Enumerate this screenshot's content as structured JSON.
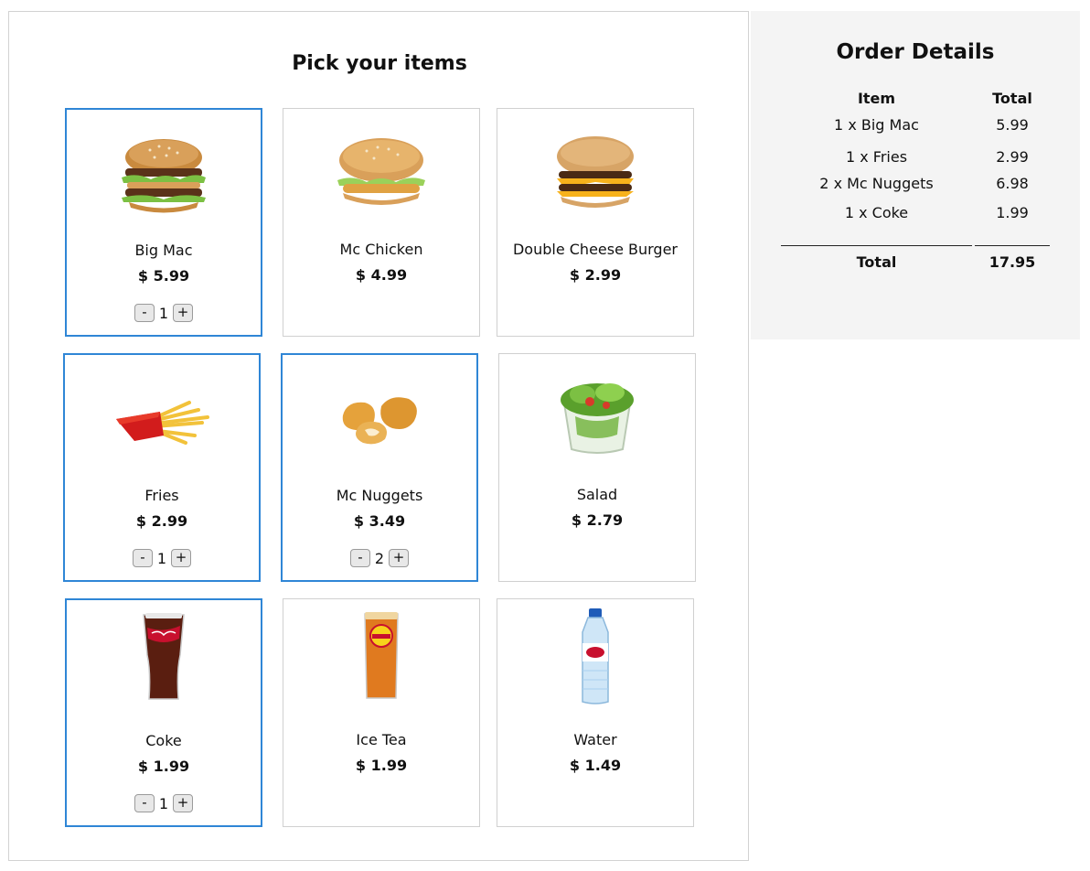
{
  "menu": {
    "title": "Pick your items",
    "items": [
      {
        "name": "Big Mac",
        "price": "$ 5.99",
        "qty": "1",
        "selected": true,
        "icon": "big-mac-image"
      },
      {
        "name": "Mc Chicken",
        "price": "$ 4.99",
        "qty": "0",
        "selected": false,
        "icon": "mc-chicken-image"
      },
      {
        "name": "Double Cheese Burger",
        "price": "$ 2.99",
        "qty": "0",
        "selected": false,
        "icon": "double-cheese-burger-image"
      },
      {
        "name": "Fries",
        "price": "$ 2.99",
        "qty": "1",
        "selected": true,
        "icon": "fries-image"
      },
      {
        "name": "Mc Nuggets",
        "price": "$ 3.49",
        "qty": "2",
        "selected": true,
        "icon": "mc-nuggets-image"
      },
      {
        "name": "Salad",
        "price": "$ 2.79",
        "qty": "0",
        "selected": false,
        "icon": "salad-image"
      },
      {
        "name": "Coke",
        "price": "$ 1.99",
        "qty": "1",
        "selected": true,
        "icon": "coke-image"
      },
      {
        "name": "Ice Tea",
        "price": "$ 1.99",
        "qty": "0",
        "selected": false,
        "icon": "ice-tea-image"
      },
      {
        "name": "Water",
        "price": "$ 1.49",
        "qty": "0",
        "selected": false,
        "icon": "water-image"
      }
    ],
    "minus_label": "-",
    "plus_label": "+"
  },
  "order": {
    "title": "Order Details",
    "col_item": "Item",
    "col_total": "Total",
    "lines": [
      {
        "item": "1 x Big Mac",
        "total": "5.99"
      },
      {
        "item": "1 x Fries",
        "total": "2.99"
      },
      {
        "item": "2 x Mc Nuggets",
        "total": "6.98"
      },
      {
        "item": "1 x Coke",
        "total": "1.99"
      }
    ],
    "total_label": "Total",
    "total_value": "17.95"
  },
  "colors": {
    "selected_border": "#2f86d6",
    "panel_bg": "#f4f4f4"
  }
}
